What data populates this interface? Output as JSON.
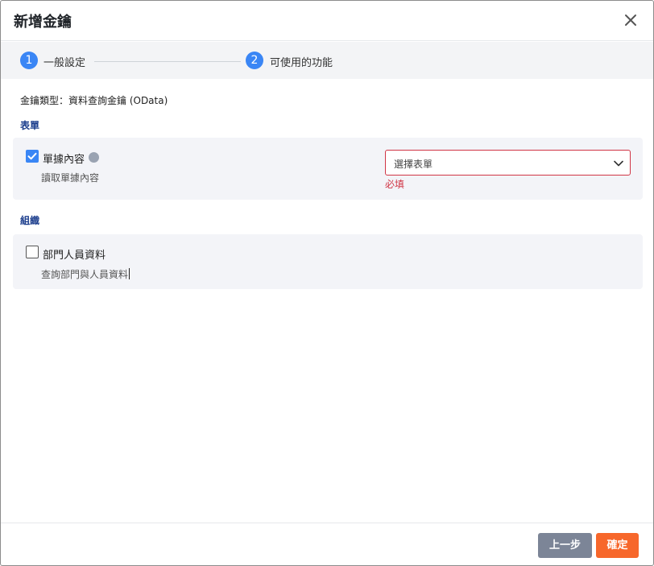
{
  "dialog": {
    "title": "新增金鑰",
    "close_icon": "close-icon"
  },
  "steps": [
    {
      "number": "1",
      "label": "一般設定",
      "active": true
    },
    {
      "number": "2",
      "label": "可使用的功能",
      "active": true
    }
  ],
  "key_type": "金鑰類型：資料查詢金鑰 (OData)",
  "sections": [
    {
      "title": "表單",
      "item": {
        "label": "單據內容",
        "description": "讀取單據內容",
        "checked": true,
        "info_icon": "info-icon",
        "select": {
          "placeholder": "選擇表單",
          "error": "必填"
        }
      }
    },
    {
      "title": "組織",
      "item": {
        "label": "部門人員資料",
        "description": "查詢部門與人員資料",
        "checked": false
      }
    }
  ],
  "footer": {
    "prev_label": "上一步",
    "confirm_label": "確定"
  },
  "colors": {
    "accent": "#3a86f5",
    "error": "#d03545",
    "confirm": "#f7672b",
    "secondary": "#7c8597",
    "section_title": "#1a3c8c"
  }
}
